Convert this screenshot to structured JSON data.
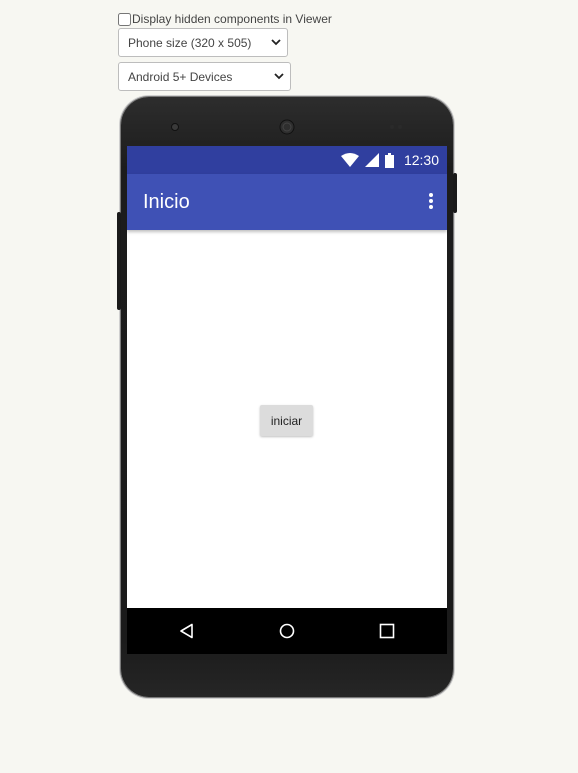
{
  "viewer_options": {
    "hidden_components_label": "Display hidden components in Viewer",
    "hidden_components_checked": false,
    "phone_size_select": "Phone size (320 x 505)",
    "device_select": "Android 5+ Devices"
  },
  "status_bar": {
    "time": "12:30",
    "color": "#303f9f"
  },
  "app_bar": {
    "title": "Inicio",
    "color": "#3f51b5"
  },
  "screen": {
    "button_label": "iniciar"
  },
  "icons": {
    "wifi": "wifi-icon",
    "signal": "signal-icon",
    "battery": "battery-icon",
    "overflow_menu": "more-vert-icon",
    "back": "back-icon",
    "home": "home-icon",
    "recents": "recents-icon"
  }
}
